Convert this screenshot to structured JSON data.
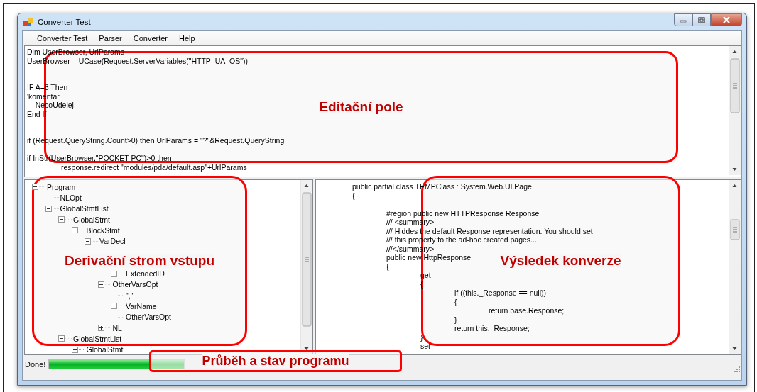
{
  "window": {
    "title": "Converter Test"
  },
  "menu": [
    {
      "label": "Converter Test"
    },
    {
      "label": "Parser"
    },
    {
      "label": "Converter"
    },
    {
      "label": "Help"
    }
  ],
  "editor": {
    "lines": [
      {
        "kind": "code",
        "text": "Dim UserBrowser, UrlParams"
      },
      {
        "kind": "code",
        "text": "UserBrowser = UCase(Request.ServerVariables(\"HTTP_UA_OS\"))"
      },
      {
        "kind": "blank"
      },
      {
        "kind": "blank"
      },
      {
        "kind": "code",
        "text": "IF A=8 Then"
      },
      {
        "kind": "code",
        "text": "'komentar"
      },
      {
        "kind": "code",
        "text": "    NecoUdelej"
      },
      {
        "kind": "code",
        "text": "End If"
      },
      {
        "kind": "blank"
      },
      {
        "kind": "blank"
      },
      {
        "kind": "code",
        "text": "if (Request.QueryString.Count>0) then UrlParams = \"?\"&Request.QueryString"
      },
      {
        "kind": "blank"
      },
      {
        "kind": "code",
        "text": "if InStr(UserBrowser,\"POCKET PC\")>0 then"
      },
      {
        "kind": "code",
        "text": "\tresponse.redirect \"modules/pda/default.asp\"+UrlParams"
      }
    ]
  },
  "tree": {
    "nodes": [
      {
        "label": "Program",
        "expanded": true,
        "selected": false,
        "children": [
          {
            "label": "NLOpt",
            "selected": false
          },
          {
            "label": "GlobalStmtList",
            "expanded": true,
            "selected": false,
            "children": [
              {
                "label": "GlobalStmt",
                "expanded": true,
                "selected": false,
                "children": [
                  {
                    "label": "BlockStmt",
                    "expanded": true,
                    "selected": false,
                    "children": [
                      {
                        "label": "VarDecl",
                        "expanded": true,
                        "selected": false,
                        "children": [
                          {
                            "kind": "covered"
                          },
                          {
                            "kind": "covered",
                            "children": [
                              {
                                "label": "ExtendedID",
                                "expanded": false,
                                "selected": false
                              }
                            ]
                          },
                          {
                            "label": "OtherVarsOpt",
                            "expanded": true,
                            "selected": false,
                            "children": [
                              {
                                "label": "\",\"",
                                "selected": false
                              },
                              {
                                "label": "VarName",
                                "expanded": false,
                                "selected": false
                              },
                              {
                                "label": "OtherVarsOpt",
                                "selected": false
                              }
                            ]
                          },
                          {
                            "label": "NL",
                            "expanded": false,
                            "selected": false
                          }
                        ]
                      }
                    ]
                  }
                ]
              },
              {
                "label": "GlobalStmtList",
                "expanded": true,
                "selected": false,
                "children": [
                  {
                    "label": "GlobalStmt",
                    "expanded": true,
                    "selected": false
                  }
                ]
              }
            ]
          }
        ]
      }
    ]
  },
  "output": {
    "lines": [
      {
        "kind": "code",
        "text": "\tpublic partial class TEMPClass : System.Web.UI.Page"
      },
      {
        "kind": "code",
        "text": "\t{"
      },
      {
        "kind": "blank"
      },
      {
        "kind": "code",
        "text": "\t\t#region public new HTTPResponse Response"
      },
      {
        "kind": "code",
        "text": "\t\t/// <summary>"
      },
      {
        "kind": "code",
        "text": "\t\t/// Hiddes the default Response representation. You should set"
      },
      {
        "kind": "code",
        "text": "\t\t/// this property to the ad-hoc created pages..."
      },
      {
        "kind": "code",
        "text": "\t\t///</summary>"
      },
      {
        "kind": "code",
        "text": "\t\tpublic new HttpResponse"
      },
      {
        "kind": "code",
        "text": "\t\t{"
      },
      {
        "kind": "code",
        "text": "\t\t\tget"
      },
      {
        "kind": "code",
        "text": "\t\t\t{"
      },
      {
        "kind": "code",
        "text": "\t\t\t\tif ((this._Response == null))"
      },
      {
        "kind": "code",
        "text": "\t\t\t\t{"
      },
      {
        "kind": "code",
        "text": "\t\t\t\t\treturn base.Response;"
      },
      {
        "kind": "code",
        "text": "\t\t\t\t}"
      },
      {
        "kind": "code",
        "text": "\t\t\t\treturn this._Response;"
      },
      {
        "kind": "code",
        "text": "\t\t\t}"
      },
      {
        "kind": "code",
        "text": "\t\t\tset"
      }
    ]
  },
  "status": {
    "text": "Done!",
    "progress": {
      "level": 1
    }
  },
  "annotations": [
    {
      "label": "Editační pole"
    },
    {
      "label": "Derivační strom vstupu"
    },
    {
      "label": "Výsledek konverze"
    },
    {
      "label": "Průběh a stav programu"
    }
  ]
}
